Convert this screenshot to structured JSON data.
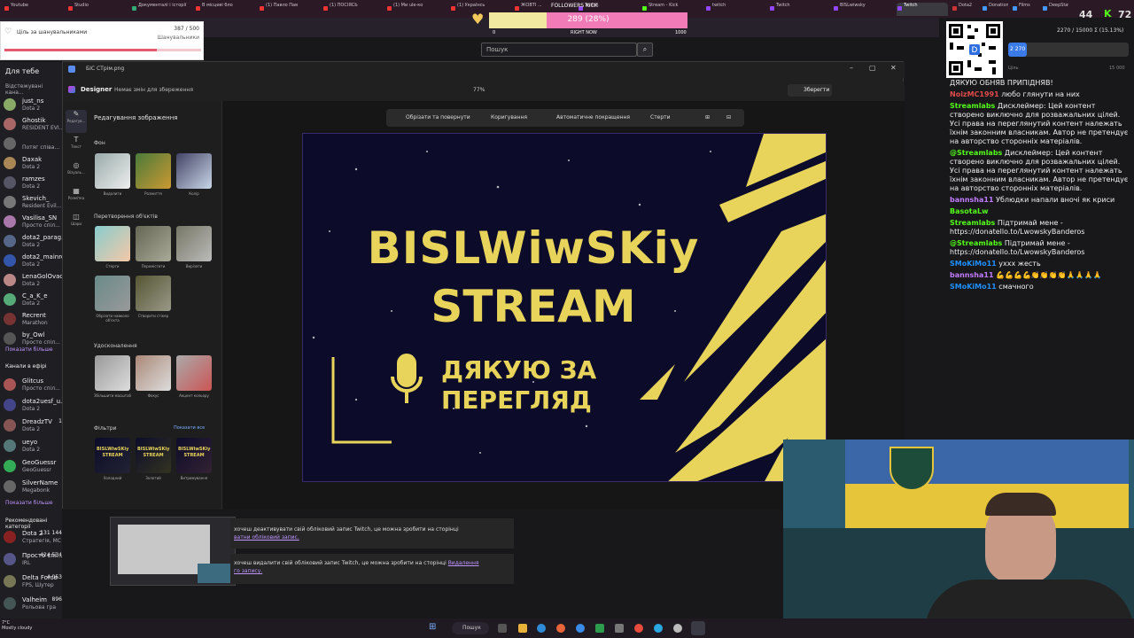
{
  "tabs": [
    {
      "label": "Youtube",
      "color": "#e33"
    },
    {
      "label": "Studio",
      "color": "#e33"
    },
    {
      "label": "Документалі і історії",
      "color": "#3a7"
    },
    {
      "label": "В місцеві бло",
      "color": "#e33"
    },
    {
      "label": "(1) Павло Пав",
      "color": "#e33"
    },
    {
      "label": "(1) ПОСІЯСЬ",
      "color": "#e33"
    },
    {
      "label": "(1) Ми ule-ко",
      "color": "#e33"
    },
    {
      "label": "(1) Українсь",
      "color": "#e33"
    },
    {
      "label": "ЖОВТІ ...",
      "color": "#e33"
    },
    {
      "label": "Twitch",
      "color": "#9146ff"
    },
    {
      "label": "Stream - Kick",
      "color": "#53fc18"
    },
    {
      "label": "twitch",
      "color": "#9146ff"
    },
    {
      "label": "Twitch",
      "color": "#9146ff"
    },
    {
      "label": "BISLwiwsky",
      "color": "#9146ff"
    },
    {
      "label": "Twitch",
      "color": "#9146ff"
    },
    {
      "label": "Dota2",
      "color": "#c33"
    },
    {
      "label": "Donations",
      "color": "#49f"
    },
    {
      "label": "Films",
      "color": "#49f"
    },
    {
      "label": "DeepState",
      "color": "#49f"
    }
  ],
  "goal": {
    "title": "Ціль за шанувальниками",
    "count": "387 / 500",
    "sub": "Шанувальники",
    "fraction": 0.774
  },
  "followers": {
    "title": "FOLLOWERS KICK",
    "progress": "289 (28%)",
    "min": "0",
    "mid": "RIGHT NOW",
    "max": "1000",
    "fraction": 0.289
  },
  "search": {
    "placeholder": "Пошук"
  },
  "kick_counter": {
    "left": "44",
    "right": "72"
  },
  "sidebar": {
    "for_you": "Для тебе",
    "followed": "Відстежувані кана...",
    "followed_items": [
      {
        "name": "just_ns",
        "game": "Dota 2",
        "color": "#8a6"
      },
      {
        "name": "Ghostik",
        "game": "RESIDENT EVI...",
        "color": "#a66"
      },
      {
        "name": "",
        "game": "Потяг співа...",
        "color": "#666"
      },
      {
        "name": "Daxak",
        "game": "Dota 2",
        "color": "#a85"
      },
      {
        "name": "ramzes",
        "game": "Dota 2",
        "color": "#556"
      },
      {
        "name": "Skevich_",
        "game": "Resident Evil...",
        "color": "#777"
      },
      {
        "name": "Vasilisa_SN",
        "game": "Просто спіл...",
        "color": "#a7a"
      },
      {
        "name": "dota2_parag...",
        "game": "Dota 2",
        "color": "#568"
      },
      {
        "name": "dota2_mainro...",
        "game": "Dota 2",
        "color": "#35a"
      },
      {
        "name": "LenaGolOvac...",
        "game": "Dota 2",
        "color": "#b88"
      },
      {
        "name": "C_a_K_e",
        "game": "Dota 2",
        "color": "#5a7"
      },
      {
        "name": "Recrent",
        "game": "Marathon",
        "color": "#733"
      },
      {
        "name": "by_Owl",
        "game": "Просто спіл...",
        "color": "#555"
      }
    ],
    "show_more_1": "Показати більше",
    "live_header": "Канали в ефірі",
    "live_items": [
      {
        "name": "Glitcus",
        "game": "Просто спіл...",
        "color": "#a55"
      },
      {
        "name": "dota2uesf_u...",
        "game": "Dota 2",
        "color": "#448"
      },
      {
        "name": "DreadzTV",
        "game": "Dota 2",
        "color": "#855",
        "viewers": "1"
      },
      {
        "name": "ueyo",
        "game": "Dota 2",
        "color": "#577"
      },
      {
        "name": "GeoGuessr",
        "game": "GeoGuessr",
        "color": "#3a5"
      },
      {
        "name": "SilverName",
        "game": "Megabonk",
        "color": "#666"
      }
    ],
    "show_more_2": "Показати більше",
    "rec_header": "Рекомендовані категорії",
    "rec_items": [
      {
        "name": "Dota 2",
        "game": "Стратегія, МС",
        "viewers": "131 144",
        "color": "#822"
      },
      {
        "name": "Просто спі...",
        "game": "IRL",
        "viewers": "424 534",
        "color": "#558"
      },
      {
        "name": "Delta Force",
        "game": "FPS, Шутер",
        "viewers": "4 053",
        "color": "#775"
      },
      {
        "name": "Valheim",
        "game": "Рольова гра",
        "viewers": "896",
        "color": "#455"
      }
    ]
  },
  "designer": {
    "window_title": "БІС СТрім.png",
    "app_name": "Designer",
    "unsaved": "Немає змін для збереження",
    "zoom": "77%",
    "save_label": "Зберегти",
    "rail": [
      "Редагув...",
      "Текст",
      "Візуаль...",
      "Розмітка",
      "Шари"
    ],
    "panel_title": "Редагування зображення",
    "bg_header": "Фон",
    "bg_items": [
      "Видалити",
      "Розмиття",
      "Колір"
    ],
    "transform_header": "Перетворення об'єктів",
    "transform_items": [
      "Стерти",
      "Перемістити",
      "Вирізати",
      "Обрізати навколо об'єкта",
      "Створити стікер"
    ],
    "improve_header": "Удосконалення",
    "improve_items": [
      "Збільшити масштаб",
      "Фокус",
      "Акцент кольору"
    ],
    "filters_header": "Фільтри",
    "filters_more": "Показати все",
    "filter_items": [
      "Холодний",
      "Золотий",
      "Витримування"
    ],
    "filter_thumb_text": "BISLWiwSKiy STREAM",
    "tools": [
      "Обрізати та повернути",
      "Коригування",
      "Автоматичне покращення",
      "Стерти"
    ],
    "art_line1": "BISLWiwSKiy",
    "art_line2": "STREAM",
    "art_thanks1": "ДЯКУЮ ЗА",
    "art_thanks2": "ПЕРЕГЛЯД"
  },
  "chat": {
    "goal_text": "2270 / 15000 Σ (15.13%)",
    "goal_badge": "2 270",
    "goal_min": "Ціль",
    "goal_max": "15 000",
    "messages": [
      {
        "user": "",
        "text": "ДЯКУЮ ОБНЯВ ПРИПІДНЯВ!",
        "color": "#efeff1"
      },
      {
        "user": "NoizMC1991",
        "text": "любо глянути на них",
        "color": "#e04b4b"
      },
      {
        "user": "Streamlabs",
        "text": "Дисклеймер: Цей контент створено виключно для розважальних цілей. Усі права на переглянутий контент належать їхнім законним власникам. Автор не претендує на авторство сторонніх матеріалів.",
        "color": "#53fc18"
      },
      {
        "user": "@Streamlabs",
        "text": "Дисклеймер: Цей контент створено виключно для розважальних цілей. Усі права на переглянутий контент належать їхнім законним власникам. Автор не претендує на авторство сторонніх матеріалів.",
        "color": "#53fc18"
      },
      {
        "user": "bannsha11",
        "text": "Ублюдки напали вночі як криси",
        "color": "#c07bff"
      },
      {
        "user": "BasotaLw",
        "text": "",
        "color": "#53fc18"
      },
      {
        "user": "Streamlabs",
        "text": "Підтримай мене - https://donatello.to/LwowskyBanderos",
        "color": "#53fc18"
      },
      {
        "user": "@Streamlabs",
        "text": "Підтримай мене - https://donatello.to/LwowskyBanderos",
        "color": "#53fc18"
      },
      {
        "user": "SMoKiMo11",
        "text": "ухxx жесть",
        "color": "#1e90ff"
      },
      {
        "user": "bannsha11",
        "text": "💪💪💪💪👏👏👏👏🙏🙏🙏🙏",
        "color": "#c07bff"
      },
      {
        "user": "SMoKiMo11",
        "text": "смачного",
        "color": "#1e90ff"
      }
    ]
  },
  "notifications": [
    {
      "text": "хочеш деактивувати свій обліковий запис Twitch, це можна зробити на сторінці",
      "link": "ватни обліковий запис."
    },
    {
      "text": "хочеш видалити свій обліковий запис Twitch, це можна зробити на сторінці",
      "link": "Видалення",
      "link2": "го запису."
    }
  ],
  "taskbar": {
    "weather_temp": "7°C",
    "weather_desc": "Mostly cloudy",
    "search": "Пошук"
  }
}
